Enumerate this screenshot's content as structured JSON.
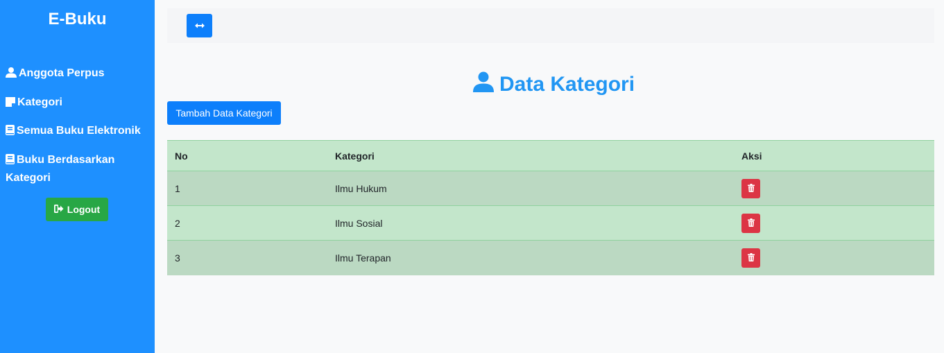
{
  "sidebar": {
    "brand": "E-Buku",
    "items": [
      {
        "label": "Anggota Perpus",
        "icon": "user-icon"
      },
      {
        "label": "Kategori",
        "icon": "note-icon"
      },
      {
        "label": "Semua Buku Elektronik",
        "icon": "book-icon"
      },
      {
        "label": "Buku Berdasarkan Kategori",
        "icon": "book-icon"
      }
    ],
    "logout_label": "Logout"
  },
  "topbar": {
    "toggle_icon": "arrows-horizontal-icon"
  },
  "main": {
    "title": "Data Kategori",
    "add_button": "Tambah Data Kategori",
    "table": {
      "headers": [
        "No",
        "Kategori",
        "Aksi"
      ],
      "rows": [
        {
          "no": "1",
          "kategori": "Ilmu Hukum"
        },
        {
          "no": "2",
          "kategori": "Ilmu Sosial"
        },
        {
          "no": "3",
          "kategori": "Ilmu Terapan"
        }
      ]
    }
  },
  "colors": {
    "sidebar": "#1e90ff",
    "primary": "#0d7ffb",
    "success": "#28a745",
    "danger": "#dc3545",
    "table_row": "#c3e6cb",
    "title": "#2196f3"
  }
}
